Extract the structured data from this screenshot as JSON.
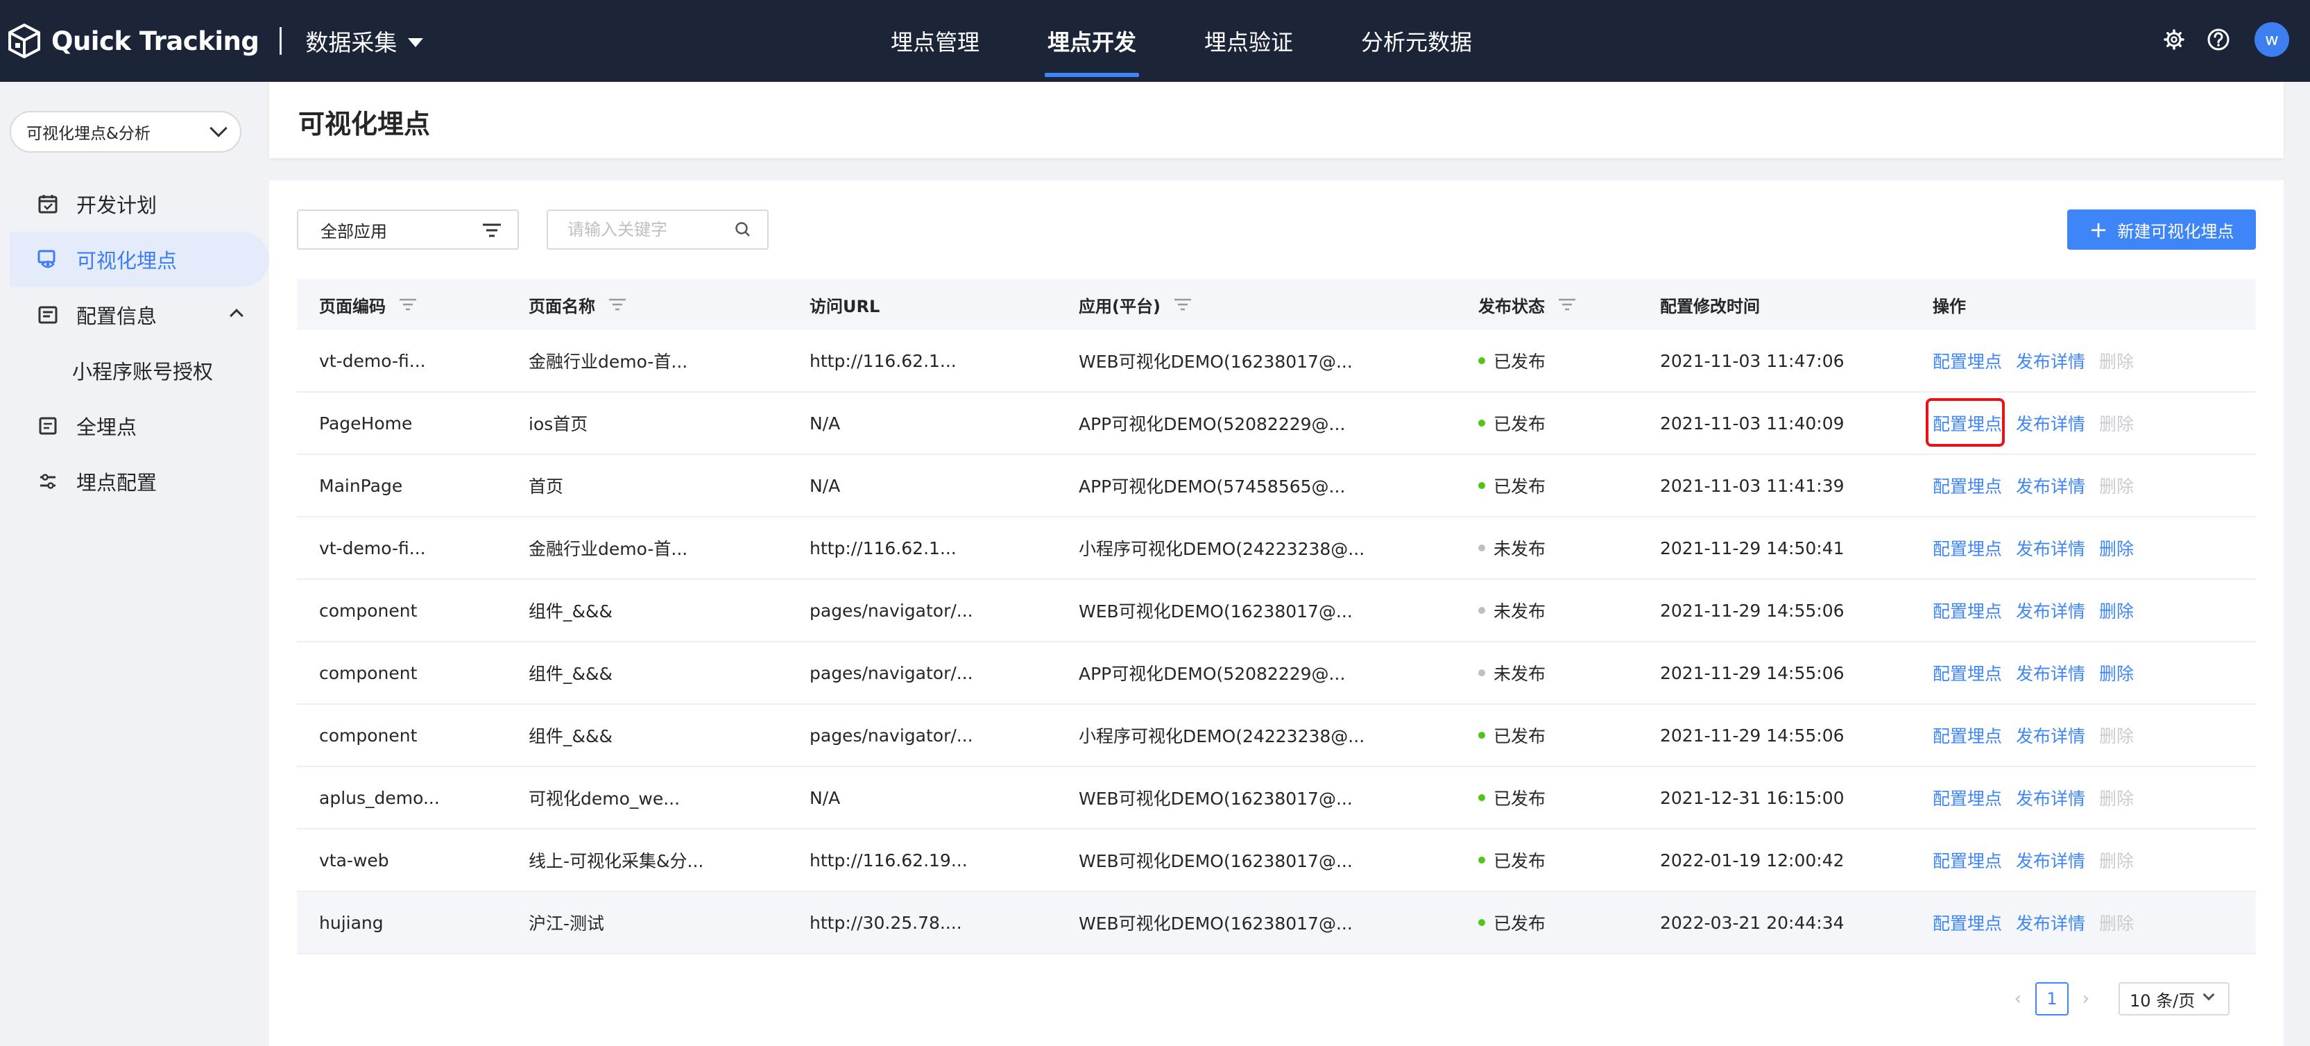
{
  "brand": {
    "name": "Quick Tracking",
    "module": "数据采集"
  },
  "nav": [
    "埋点管理",
    "埋点开发",
    "埋点验证",
    "分析元数据"
  ],
  "nav_active_index": 1,
  "user": {
    "avatar_letter": "w"
  },
  "sidebar": {
    "project": "可视化埋点&分析",
    "items": [
      {
        "label": "开发计划",
        "icon": "calendar-icon"
      },
      {
        "label": "可视化埋点",
        "icon": "eye-icon",
        "active": true
      },
      {
        "label": "配置信息",
        "icon": "config-icon",
        "expanded": true
      },
      {
        "label": "小程序账号授权",
        "sub": true
      },
      {
        "label": "全埋点",
        "icon": "list-icon"
      },
      {
        "label": "埋点配置",
        "icon": "sliders-icon"
      }
    ]
  },
  "page": {
    "title": "可视化埋点"
  },
  "toolbar": {
    "filter_value": "全部应用",
    "search_placeholder": "请输入关键字",
    "new_button": "新建可视化埋点"
  },
  "table": {
    "columns": [
      "页面编码",
      "页面名称",
      "访问URL",
      "应用(平台)",
      "发布状态",
      "配置修改时间",
      "操作"
    ],
    "actions": {
      "config": "配置埋点",
      "detail": "发布详情",
      "delete": "删除"
    },
    "rows": [
      {
        "code": "vt-demo-fi...",
        "name": "金融行业demo-首...",
        "url": "http://116.62.1...",
        "app": "WEB可视化DEMO(16238017@...",
        "status": "已发布",
        "time": "2021-11-03 11:47:06",
        "delete_enabled": false
      },
      {
        "code": "PageHome",
        "name": "ios首页",
        "url": "N/A",
        "app": "APP可视化DEMO(52082229@...",
        "status": "已发布",
        "time": "2021-11-03 11:40:09",
        "delete_enabled": false,
        "highlight": "4"
      },
      {
        "code": "MainPage",
        "name": "首页",
        "url": "N/A",
        "app": "APP可视化DEMO(57458565@...",
        "status": "已发布",
        "time": "2021-11-03 11:41:39",
        "delete_enabled": false
      },
      {
        "code": "vt-demo-fi...",
        "name": "金融行业demo-首...",
        "url": "http://116.62.1...",
        "app": "小程序可视化DEMO(24223238@...",
        "status": "未发布",
        "time": "2021-11-29 14:50:41",
        "delete_enabled": true
      },
      {
        "code": "component",
        "name": "组件_&&&",
        "url": "pages/navigator/...",
        "app": "WEB可视化DEMO(16238017@...",
        "status": "未发布",
        "time": "2021-11-29 14:55:06",
        "delete_enabled": true
      },
      {
        "code": "component",
        "name": "组件_&&&",
        "url": "pages/navigator/...",
        "app": "APP可视化DEMO(52082229@...",
        "status": "未发布",
        "time": "2021-11-29 14:55:06",
        "delete_enabled": true
      },
      {
        "code": "component",
        "name": "组件_&&&",
        "url": "pages/navigator/...",
        "app": "小程序可视化DEMO(24223238@...",
        "status": "已发布",
        "time": "2021-11-29 14:55:06",
        "delete_enabled": false
      },
      {
        "code": "aplus_demo...",
        "name": "可视化demo_we...",
        "url": "N/A",
        "app": "WEB可视化DEMO(16238017@...",
        "status": "已发布",
        "time": "2021-12-31 16:15:00",
        "delete_enabled": false
      },
      {
        "code": "vta-web",
        "name": "线上-可视化采集&分...",
        "url": "http://116.62.19...",
        "app": "WEB可视化DEMO(16238017@...",
        "status": "已发布",
        "time": "2022-01-19 12:00:42",
        "delete_enabled": false
      },
      {
        "code": "hujiang",
        "name": "沪江-测试",
        "url": "http://30.25.78....",
        "app": "WEB可视化DEMO(16238017@...",
        "status": "已发布",
        "time": "2022-03-21 20:44:34",
        "delete_enabled": false,
        "hover": true
      }
    ]
  },
  "pagination": {
    "current_page": "1",
    "page_size": "10 条/页"
  },
  "colors": {
    "accent": "#3e86f7",
    "published": "#52c41a",
    "unpublished": "#bfbfbf",
    "topbar": "#1c2438",
    "annotation": "#e8121b"
  }
}
